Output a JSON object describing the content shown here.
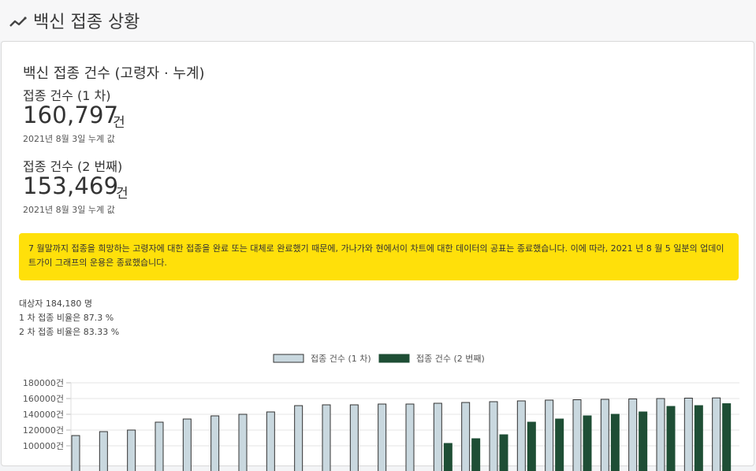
{
  "page": {
    "title": "백신 접종 상황",
    "icon": "trending-line-icon"
  },
  "card": {
    "title": "백신 접종 건수 (고령자 · 누계)",
    "dose1": {
      "label": "접종 건수 (1 차)",
      "value": "160,797",
      "unit": "건",
      "note": "2021년 8월 3일 누계 값"
    },
    "dose2": {
      "label": "접종 건수 (2 번째)",
      "value": "153,469",
      "unit": "건",
      "note": "2021년 8월 3일 누계 값"
    },
    "notice": "7 월말까지 접종을 희망하는 고령자에 대한 접종을 완료 또는 대체로 완료했기 때문에, 가나가와 현에서이 차트에 대한 데이터의 공표는 종료했습니다. 이에 따라, 2021 년 8 월 5 일분의 업데이트가이 그래프의 운용은 종료했습니다.",
    "summary": {
      "target": "대상자 184,180 명",
      "rate1": "1 차 접종 비율은 87.3 %",
      "rate2": "2 차 접종 비율은 83.33 %"
    }
  },
  "colors": {
    "dose1": "#c9d8df",
    "dose2": "#1e4e35",
    "notice": "#ffe00a"
  },
  "chart_data": {
    "type": "bar",
    "series": [
      {
        "name": "접종 건수 (1 차)",
        "values": [
          113000,
          118000,
          120000,
          130000,
          134000,
          138000,
          140000,
          143000,
          151000,
          152000,
          152000,
          153000,
          153000,
          154000,
          155000,
          156000,
          157000,
          158000,
          158500,
          159000,
          159500,
          160000,
          160500,
          160797
        ]
      },
      {
        "name": "접종 건수 (2 번째)",
        "values": [
          null,
          null,
          null,
          null,
          null,
          null,
          null,
          null,
          null,
          null,
          null,
          null,
          null,
          103000,
          109000,
          114000,
          130000,
          134000,
          138000,
          140000,
          143000,
          150000,
          151000,
          153469
        ]
      }
    ],
    "y_ticks": [
      "180000건",
      "160000건",
      "140000건",
      "120000건",
      "100000건"
    ],
    "ylim": [
      100000,
      180000
    ],
    "legend": "top-center",
    "grid": true
  }
}
